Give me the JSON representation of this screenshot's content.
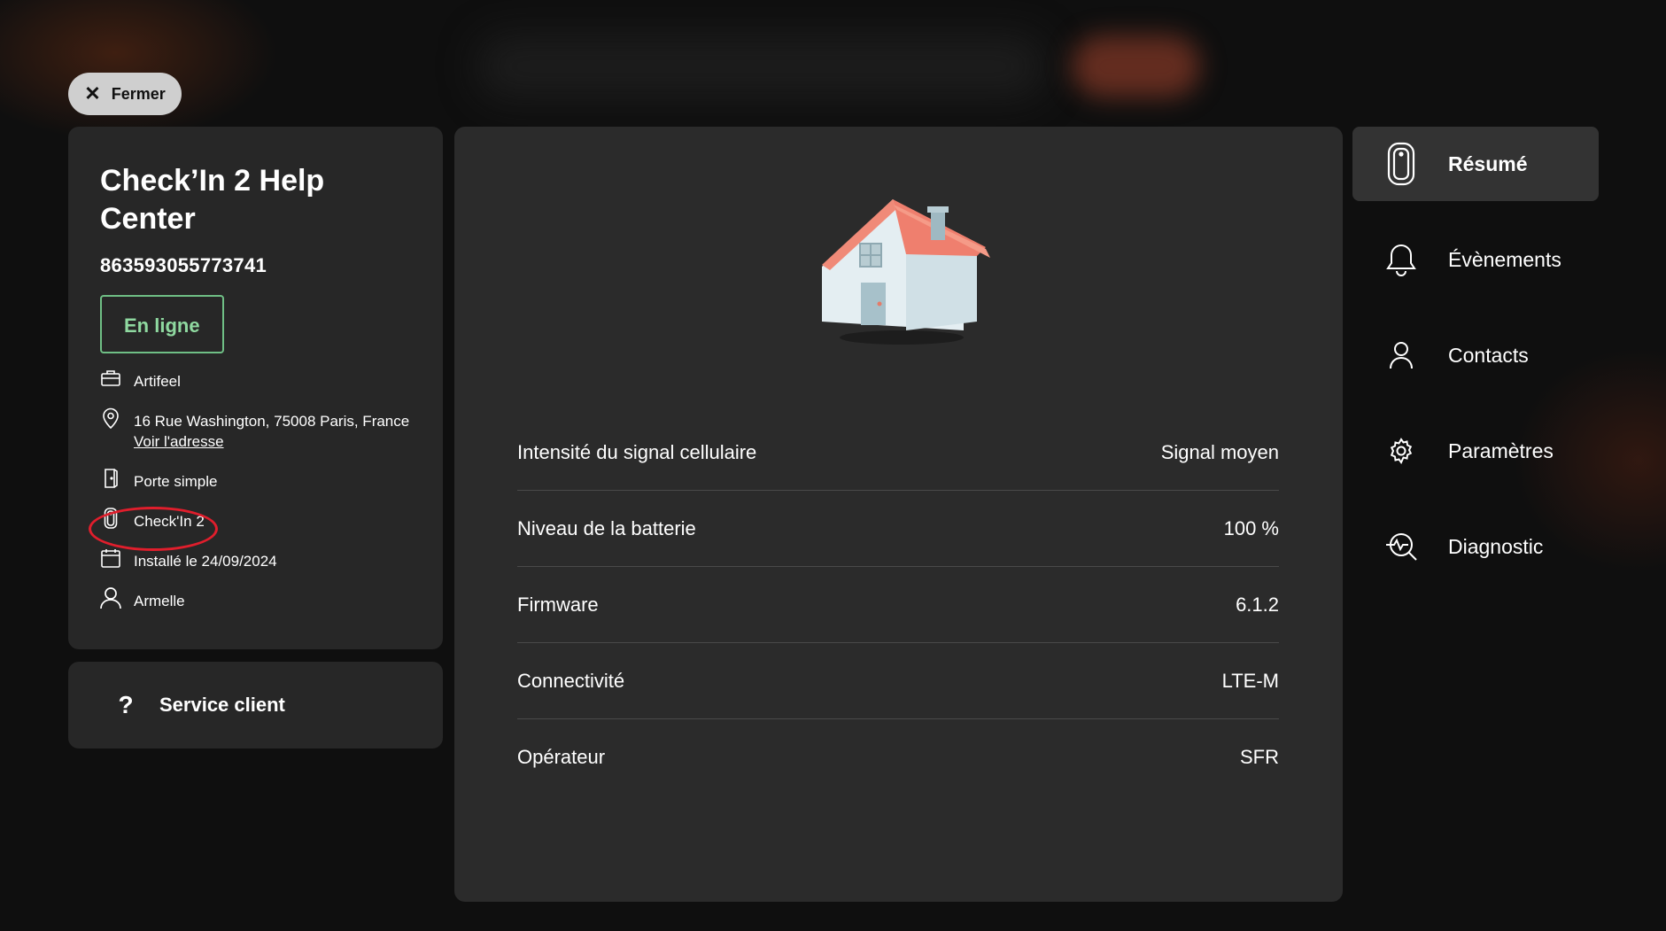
{
  "close_button": {
    "label": "Fermer"
  },
  "device": {
    "title": "Check’In 2 Help Center",
    "serial": "863593055773741",
    "status": "En ligne",
    "company": "Artifeel",
    "address": "16 Rue Washington, 75008 Paris, France",
    "address_link": "Voir l'adresse",
    "door_type": "Porte simple",
    "model": "Check'In 2",
    "installed": "Installé le 24/09/2024",
    "installer": "Armelle"
  },
  "service": {
    "label": "Service client"
  },
  "stats": [
    {
      "label": "Intensité du signal cellulaire",
      "value": "Signal moyen"
    },
    {
      "label": "Niveau de la batterie",
      "value": "100 %"
    },
    {
      "label": "Firmware",
      "value": "6.1.2"
    },
    {
      "label": "Connectivité",
      "value": "LTE-M"
    },
    {
      "label": "Opérateur",
      "value": "SFR"
    }
  ],
  "nav": [
    {
      "label": "Résumé",
      "icon": "device-icon",
      "active": true
    },
    {
      "label": "Évènements",
      "icon": "bell-icon"
    },
    {
      "label": "Contacts",
      "icon": "user-icon"
    },
    {
      "label": "Paramètres",
      "icon": "gear-icon"
    },
    {
      "label": "Diagnostic",
      "icon": "diagnostic-icon"
    }
  ],
  "colors": {
    "status_green": "#6fbf85",
    "highlight_red": "#e01e2c",
    "panel": "#2b2b2b"
  }
}
